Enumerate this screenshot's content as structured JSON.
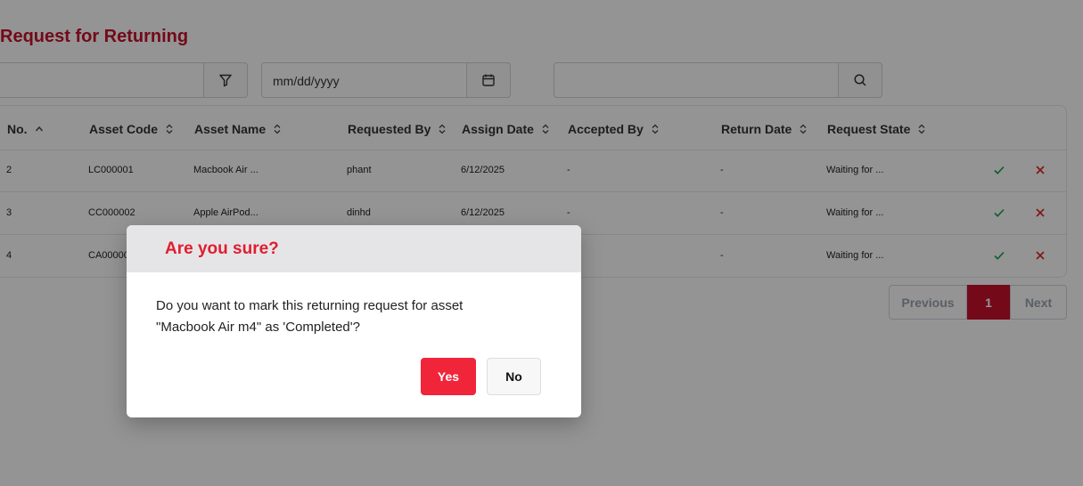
{
  "page": {
    "title": "Request for Returning"
  },
  "filters": {
    "state_value": "",
    "date_placeholder": "mm/dd/yyyy",
    "search_value": ""
  },
  "table": {
    "headers": [
      "No.",
      "Asset Code",
      "Asset Name",
      "Requested By",
      "Assign Date",
      "Accepted By",
      "Return Date",
      "Request State"
    ],
    "rows": [
      {
        "no": "2",
        "code": "LC000001",
        "name": "Macbook Air ...",
        "requested_by": "phant",
        "assign_date": "6/12/2025",
        "accepted_by": "-",
        "return_date": "-",
        "state": "Waiting for ..."
      },
      {
        "no": "3",
        "code": "CC000002",
        "name": "Apple AirPod...",
        "requested_by": "dinhd",
        "assign_date": "6/12/2025",
        "accepted_by": "-",
        "return_date": "-",
        "state": "Waiting for ..."
      },
      {
        "no": "4",
        "code": "CA00000",
        "name": "",
        "requested_by": "",
        "assign_date": "",
        "accepted_by": "",
        "return_date": "-",
        "state": "Waiting for ..."
      }
    ]
  },
  "pagination": {
    "previous": "Previous",
    "current": "1",
    "next": "Next"
  },
  "dialog": {
    "title": "Are you sure?",
    "message_line1": "Do you want to mark this returning request for asset",
    "message_line2": "\"Macbook Air m4\" as 'Completed'?",
    "yes_label": "Yes",
    "no_label": "No"
  },
  "colors": {
    "brand": "#c8102e",
    "confirm": "#f0253a",
    "check": "#16a34a",
    "cross": "#dc2626"
  }
}
